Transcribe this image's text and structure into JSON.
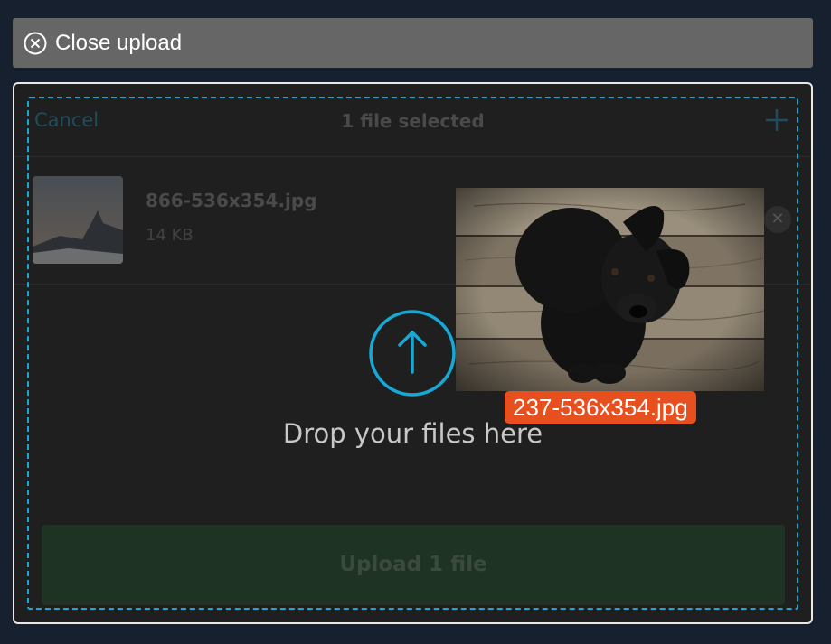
{
  "close_bar": {
    "label": "Close upload",
    "icon": "close-circle-icon"
  },
  "dashboard": {
    "cancel_label": "Cancel",
    "selected_count": "1 file selected",
    "add_icon": "plus-icon",
    "files": [
      {
        "name": "866-536x354.jpg",
        "size": "14 KB",
        "remove_icon": "remove-icon"
      }
    ],
    "upload_button_label": "Upload 1 file"
  },
  "dropzone": {
    "text": "Drop your files here",
    "icon": "arrow-up-circle-icon"
  },
  "drag_preview": {
    "file_name": "237-536x354.jpg"
  },
  "colors": {
    "accent": "#16a9d6",
    "drag_label_bg": "#e84f1e",
    "upload_button_bg": "#1f3325"
  }
}
